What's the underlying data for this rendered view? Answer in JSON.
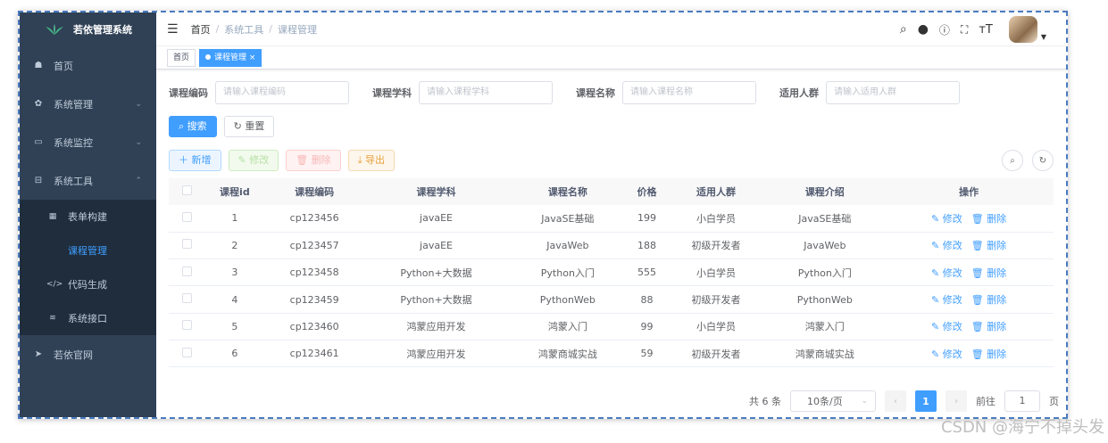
{
  "app": {
    "title": "若依管理系统"
  },
  "sidebar": {
    "items": [
      {
        "label": "首页",
        "icon": "dashboard-icon",
        "glyph": "☗"
      },
      {
        "label": "系统管理",
        "icon": "gear-icon",
        "glyph": "✿",
        "arrow": "⌄"
      },
      {
        "label": "系统监控",
        "icon": "monitor-icon",
        "glyph": "▭",
        "arrow": "⌄"
      },
      {
        "label": "系统工具",
        "icon": "toolbox-icon",
        "glyph": "⊟",
        "arrow": "⌃"
      }
    ],
    "subitems": [
      {
        "label": "表单构建",
        "icon": "form-icon",
        "glyph": "▦"
      },
      {
        "label": "课程管理",
        "active": true
      },
      {
        "label": "代码生成",
        "icon": "code-icon",
        "glyph": "</>"
      },
      {
        "label": "系统接口",
        "icon": "api-icon",
        "glyph": "≋"
      }
    ],
    "footer_item": {
      "label": "若依官网",
      "icon": "send-icon",
      "glyph": "➤"
    }
  },
  "navbar": {
    "breadcrumb": [
      "首页",
      "系统工具",
      "课程管理"
    ],
    "separator": "/",
    "icons": [
      "search-icon",
      "github-icon",
      "help-icon",
      "fullscreen-icon",
      "font-size-icon"
    ]
  },
  "tags": [
    {
      "label": "首页",
      "active": false
    },
    {
      "label": "课程管理",
      "active": true,
      "close": "×"
    }
  ],
  "query": {
    "fields": [
      {
        "label": "课程编码",
        "placeholder": "请输入课程编码"
      },
      {
        "label": "课程学科",
        "placeholder": "请输入课程学科"
      },
      {
        "label": "课程名称",
        "placeholder": "请输入课程名称"
      },
      {
        "label": "适用人群",
        "placeholder": "请输入适用人群"
      }
    ],
    "search_label": "搜索",
    "reset_label": "重置"
  },
  "toolbar": {
    "add_label": "新增",
    "edit_label": "修改",
    "delete_label": "删除",
    "export_label": "导出"
  },
  "table": {
    "columns": [
      "课程id",
      "课程编码",
      "课程学科",
      "课程名称",
      "价格",
      "适用人群",
      "课程介绍",
      "操作"
    ],
    "rows": [
      [
        "1",
        "cp123456",
        "javaEE",
        "JavaSE基础",
        "199",
        "小白学员",
        "JavaSE基础"
      ],
      [
        "2",
        "cp123457",
        "javaEE",
        "JavaWeb",
        "188",
        "初级开发者",
        "JavaWeb"
      ],
      [
        "3",
        "cp123458",
        "Python+大数据",
        "Python入门",
        "555",
        "小白学员",
        "Python入门"
      ],
      [
        "4",
        "cp123459",
        "Python+大数据",
        "PythonWeb",
        "88",
        "初级开发者",
        "PythonWeb"
      ],
      [
        "5",
        "cp123460",
        "鸿蒙应用开发",
        "鸿蒙入门",
        "99",
        "小白学员",
        "鸿蒙入门"
      ],
      [
        "6",
        "cp123461",
        "鸿蒙应用开发",
        "鸿蒙商城实战",
        "59",
        "初级开发者",
        "鸿蒙商城实战"
      ]
    ],
    "row_edit": "修改",
    "row_delete": "删除"
  },
  "pagination": {
    "total_text": "共 6 条",
    "page_size": "10条/页",
    "current_page": "1",
    "goto_label": "前往",
    "goto_value": "1",
    "page_suffix": "页"
  },
  "watermark": "CSDN @海宁不掉头发",
  "colors": {
    "primary": "#409eff",
    "sidebar_bg": "#304156",
    "submenu_bg": "#1f2d3d"
  }
}
